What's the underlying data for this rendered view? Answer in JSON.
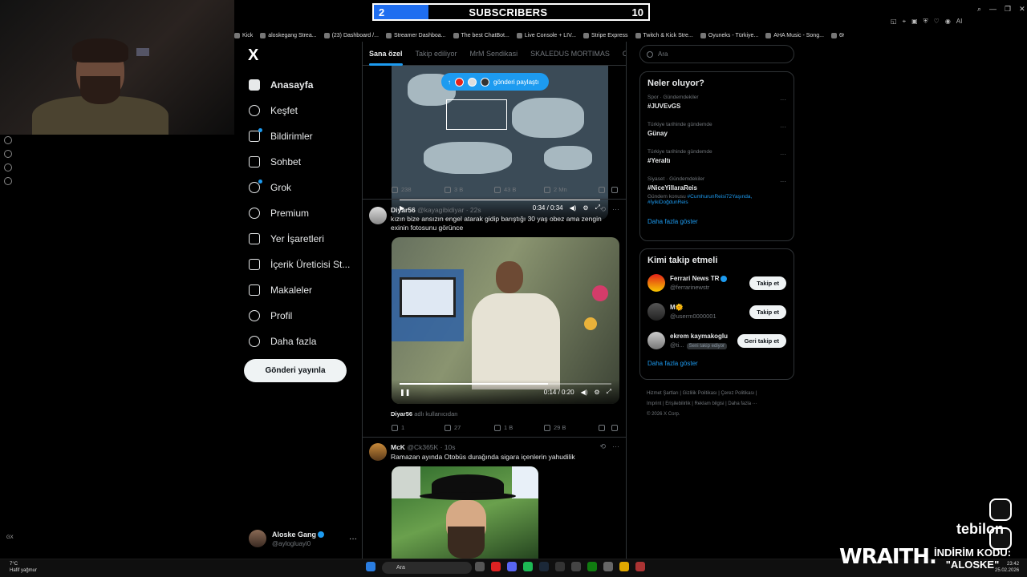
{
  "stream": {
    "subscribers_label": "SUBSCRIBERS",
    "current": "2",
    "goal": "10",
    "progress": 0.2,
    "brand": "WRAITH.",
    "discount_line1": "İNDİRİM KODU:",
    "discount_line2": "\"ALOSKE\"",
    "sponsor": "tebilon"
  },
  "bookmarks": [
    "Kick",
    "aloskegang Strea...",
    "(23) Dashboard /...",
    "Streamer Dashboa...",
    "The best ChatBot...",
    "Live Console + LIV...",
    "Stripe Express",
    "Twitch & Kick Stre...",
    "Oyuneks - Türkiye...",
    "AHA Music - Song...",
    "6K Labs"
  ],
  "nav": {
    "logo": "X",
    "items": [
      {
        "label": "Anasayfa",
        "icon": "home-icon"
      },
      {
        "label": "Keşfet",
        "icon": "search-icon"
      },
      {
        "label": "Bildirimler",
        "icon": "bell-icon"
      },
      {
        "label": "Sohbet",
        "icon": "mail-icon"
      },
      {
        "label": "Grok",
        "icon": "grok-icon"
      },
      {
        "label": "Premium",
        "icon": "premium-icon"
      },
      {
        "label": "Yer İşaretleri",
        "icon": "bookmark-icon"
      },
      {
        "label": "İçerik Üreticisi St...",
        "icon": "creator-studio-icon"
      },
      {
        "label": "Makaleler",
        "icon": "articles-icon"
      },
      {
        "label": "Profil",
        "icon": "profile-icon"
      },
      {
        "label": "Daha fazla",
        "icon": "more-circle-icon"
      }
    ],
    "post_button": "Gönderi yayınla"
  },
  "account": {
    "name": "Aloske Gang",
    "handle": "@aylogluayi0",
    "more": "···"
  },
  "tabs": [
    "Sana özel",
    "Takip ediliyor",
    "MrM Sendikasi",
    "SKALEDUS MORTIMAS",
    "Oyu"
  ],
  "post1": {
    "notify": "gönderi paylaştı",
    "time": "0:34 / 0:34",
    "progress": 1.0,
    "replies": "238",
    "reposts": "3 B",
    "likes": "43 B",
    "views": "2 Mn"
  },
  "post2": {
    "name": "Diyar56",
    "handle": "@kayagibidiyar",
    "age": "22s",
    "text": "kızın bize ansızın engel atarak gidip barıştığı 30 yaş obez ama zengin exinin fotosunu görünce",
    "time": "0:14 / 0:20",
    "progress": 0.7,
    "credit_name": "Diyar56",
    "credit_text": "adlı kullanıcıdan",
    "replies": "1",
    "reposts": "27",
    "likes": "1 B",
    "views": "29 B"
  },
  "post3": {
    "name": "McK",
    "handle": "@Ck365K",
    "age": "10s",
    "text": "Ramazan ayında Otobüs durağında sigara içenlerin yahudilik"
  },
  "search": {
    "placeholder": "Ara"
  },
  "trends": {
    "title": "Neler oluyor?",
    "items": [
      {
        "context": "Spor · Gündemdekiler",
        "topic": "#JUVEvGS"
      },
      {
        "context": "Türkiye tarihinde gündemde",
        "topic": "Günay"
      },
      {
        "context": "Türkiye tarihinde gündemde",
        "topic": "#Yeraltı"
      },
      {
        "context": "Siyaset · Gündemdekiler",
        "topic": "#NiceYillaraReis",
        "sub_label": "Gündem konusu",
        "sub_links": "#CumhurunReisi72Yaşında, #İyikiDoğdunReis"
      }
    ],
    "show_more": "Daha fazla göster"
  },
  "who_to_follow": {
    "title": "Kimi takip etmeli",
    "items": [
      {
        "name": "Ferrari News TR",
        "handle": "@ferrarinewstr",
        "button": "Takip et",
        "verified": true
      },
      {
        "name": "M🌞",
        "handle": "@userm0000001",
        "button": "Takip et",
        "verified": false
      },
      {
        "name": "ekrem kaymakoglu",
        "handle": "@ti...",
        "tag": "Seni takip ediyor",
        "button": "Geri takip et",
        "verified": false
      }
    ],
    "show_more": "Daha fazla göster"
  },
  "footer": {
    "line1": "Hizmet Şartları  |  Gizlilik Politikası  |  Çerez Politikası  |",
    "line2": "Imprint  |  Erişilebilirlik  |  Reklam bilgisi  |  Daha fazla ···",
    "line3": "© 2026 X Corp."
  },
  "taskbar": {
    "search": "Ara",
    "weather_temp": "7°C",
    "weather_desc": "Hafif yağmur",
    "time": "23:42",
    "date": "25.02.2026"
  },
  "gx_label": "GX",
  "colors": {
    "accent": "#1d9bf0",
    "subbar": "#1f6ef0",
    "bg": "#000000"
  }
}
